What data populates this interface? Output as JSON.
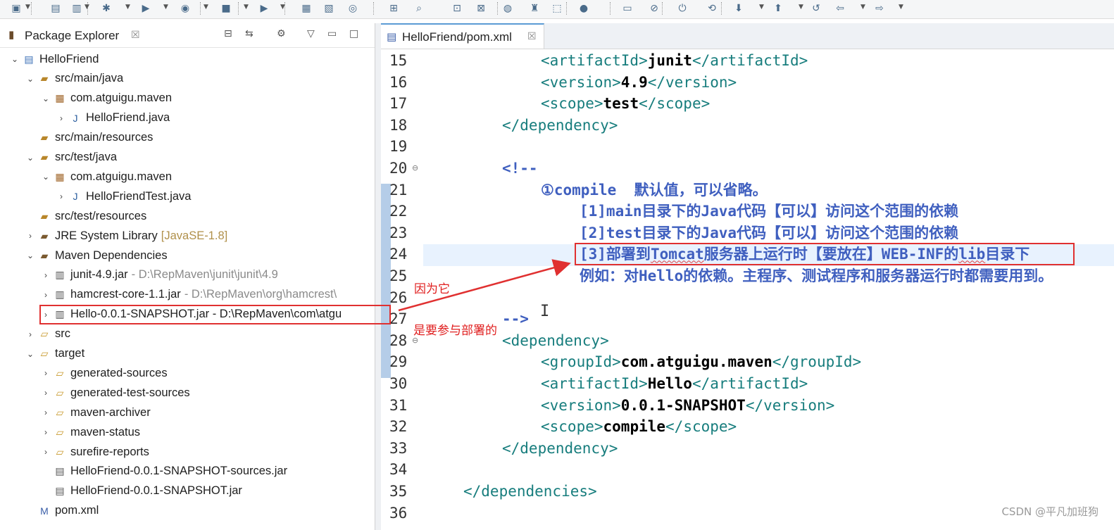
{
  "toolbar": {
    "buttons": [
      "new-icon",
      "save-icon",
      "save-all-icon",
      "debug-icon",
      "run-icon",
      "coverage-icon",
      "stop-icon",
      "external-tools-icon",
      "new-java-project-icon",
      "new-package-icon",
      "new-class-icon",
      "open-type-icon",
      "search-icon",
      "open-task-icon",
      "open-resource-icon",
      "web-browser-icon",
      "ant-icon",
      "remote-icon",
      "user-icon",
      "console-icon",
      "pin-icon",
      "server-start-icon",
      "server-stop-icon",
      "next-annotation-icon",
      "prev-annotation-icon",
      "last-edit-icon",
      "back-icon",
      "forward-icon"
    ]
  },
  "explorer": {
    "title": "Package Explorer",
    "close_glyph": "☒",
    "tree": [
      {
        "label": "HelloFriend",
        "extra": "",
        "level": 0,
        "expand": "open",
        "icon": "project-icon"
      },
      {
        "label": "src/main/java",
        "extra": "",
        "level": 1,
        "expand": "open",
        "icon": "source-folder-icon"
      },
      {
        "label": "com.atguigu.maven",
        "extra": "",
        "level": 2,
        "expand": "open",
        "icon": "package-icon"
      },
      {
        "label": "HelloFriend.java",
        "extra": "",
        "level": 3,
        "expand": "closed",
        "icon": "java-file-icon"
      },
      {
        "label": "src/main/resources",
        "extra": "",
        "level": 1,
        "expand": "none",
        "icon": "source-folder-icon"
      },
      {
        "label": "src/test/java",
        "extra": "",
        "level": 1,
        "expand": "open",
        "icon": "source-folder-icon"
      },
      {
        "label": "com.atguigu.maven",
        "extra": "",
        "level": 2,
        "expand": "open",
        "icon": "package-icon"
      },
      {
        "label": "HelloFriendTest.java",
        "extra": "",
        "level": 3,
        "expand": "closed",
        "icon": "java-file-icon"
      },
      {
        "label": "src/test/resources",
        "extra": "",
        "level": 1,
        "expand": "none",
        "icon": "source-folder-icon"
      },
      {
        "label": "JRE System Library",
        "extra": "[JavaSE-1.8]",
        "level": 1,
        "expand": "closed",
        "icon": "library-icon"
      },
      {
        "label": "Maven Dependencies",
        "extra": "",
        "level": 1,
        "expand": "open",
        "icon": "library-icon"
      },
      {
        "label": "junit-4.9.jar",
        "extra": "- D:\\RepMaven\\junit\\junit\\4.9",
        "level": 2,
        "expand": "closed",
        "icon": "jar-icon"
      },
      {
        "label": "hamcrest-core-1.1.jar",
        "extra": "- D:\\RepMaven\\org\\hamcrest\\",
        "level": 2,
        "expand": "closed",
        "icon": "jar-icon"
      },
      {
        "label": "Hello-0.0.1-SNAPSHOT.jar - D:\\RepMaven\\com\\atgu",
        "extra": "",
        "level": 2,
        "expand": "closed",
        "icon": "jar-icon"
      },
      {
        "label": "src",
        "extra": "",
        "level": 1,
        "expand": "closed",
        "icon": "folder-icon"
      },
      {
        "label": "target",
        "extra": "",
        "level": 1,
        "expand": "open",
        "icon": "folder-icon"
      },
      {
        "label": "generated-sources",
        "extra": "",
        "level": 2,
        "expand": "closed",
        "icon": "folder-icon"
      },
      {
        "label": "generated-test-sources",
        "extra": "",
        "level": 2,
        "expand": "closed",
        "icon": "folder-icon"
      },
      {
        "label": "maven-archiver",
        "extra": "",
        "level": 2,
        "expand": "closed",
        "icon": "folder-icon"
      },
      {
        "label": "maven-status",
        "extra": "",
        "level": 2,
        "expand": "closed",
        "icon": "folder-icon"
      },
      {
        "label": "surefire-reports",
        "extra": "",
        "level": 2,
        "expand": "closed",
        "icon": "folder-icon"
      },
      {
        "label": "HelloFriend-0.0.1-SNAPSHOT-sources.jar",
        "extra": "",
        "level": 2,
        "expand": "none",
        "icon": "archive-icon"
      },
      {
        "label": "HelloFriend-0.0.1-SNAPSHOT.jar",
        "extra": "",
        "level": 2,
        "expand": "none",
        "icon": "archive-icon"
      },
      {
        "label": "pom.xml",
        "extra": "",
        "level": 1,
        "expand": "none",
        "icon": "xml-file-icon"
      }
    ]
  },
  "editor": {
    "tab_title": "HelloFriend/pom.xml",
    "close_glyph": "☒",
    "line_numbers": [
      "15",
      "16",
      "17",
      "18",
      "19",
      "20",
      "21",
      "22",
      "23",
      "24",
      "25",
      "26",
      "27",
      "28",
      "29",
      "30",
      "31",
      "32",
      "33",
      "34",
      "35",
      "36"
    ],
    "lines": [
      [
        {
          "c": "tag",
          "t": "<artifactId>"
        },
        {
          "c": "txt",
          "t": "junit"
        },
        {
          "c": "tag",
          "t": "</artifactId>"
        }
      ],
      [
        {
          "c": "tag",
          "t": "<version>"
        },
        {
          "c": "txt",
          "t": "4.9"
        },
        {
          "c": "tag",
          "t": "</version>"
        }
      ],
      [
        {
          "c": "tag",
          "t": "<scope>"
        },
        {
          "c": "txt",
          "t": "test"
        },
        {
          "c": "tag",
          "t": "</scope>"
        }
      ],
      [
        {
          "c": "tag",
          "t": "</dependency>"
        }
      ],
      [],
      [
        {
          "c": "cmt",
          "t": "<!--"
        }
      ],
      [
        {
          "c": "cmt",
          "t": "①compile  默认值，可以省略。"
        }
      ],
      [
        {
          "c": "cmt",
          "t": "[1]main目录下的Java代码【可以】访问这个范围的依赖"
        }
      ],
      [
        {
          "c": "cmt",
          "t": "[2]test目录下的Java代码【可以】访问这个范围的依赖"
        }
      ],
      [
        {
          "c": "cmt",
          "t": "[3]部署到"
        },
        {
          "c": "cmt u",
          "t": "Tomcat"
        },
        {
          "c": "cmt",
          "t": "服务器上运行时【要放在】WEB-INF的"
        },
        {
          "c": "cmt u",
          "t": "lib"
        },
        {
          "c": "cmt",
          "t": "目录下"
        }
      ],
      [
        {
          "c": "cmt",
          "t": "例如：对Hello的依赖。主程序、测试程序和服务器运行时都需要用到。"
        }
      ],
      [],
      [
        {
          "c": "cmt",
          "t": "-->"
        }
      ],
      [
        {
          "c": "tag",
          "t": "<dependency>"
        }
      ],
      [
        {
          "c": "tag",
          "t": "<groupId>"
        },
        {
          "c": "txt",
          "t": "com.atguigu.maven"
        },
        {
          "c": "tag",
          "t": "</groupId>"
        }
      ],
      [
        {
          "c": "tag",
          "t": "<artifactId>"
        },
        {
          "c": "txt",
          "t": "Hello"
        },
        {
          "c": "tag",
          "t": "</artifactId>"
        }
      ],
      [
        {
          "c": "tag",
          "t": "<version>"
        },
        {
          "c": "txt",
          "t": "0.0.1-SNAPSHOT"
        },
        {
          "c": "tag",
          "t": "</version>"
        }
      ],
      [
        {
          "c": "tag",
          "t": "<scope>"
        },
        {
          "c": "txt",
          "t": "compile"
        },
        {
          "c": "tag",
          "t": "</scope>"
        }
      ],
      [
        {
          "c": "tag",
          "t": "</dependency>"
        }
      ],
      [],
      [
        {
          "c": "tag",
          "t": "</dependencies>"
        }
      ],
      []
    ]
  },
  "annotations": {
    "note_1": "因为它",
    "note_2": "是要参与部署的",
    "color": "#e03030"
  },
  "watermark": "CSDN @平凡加班狗"
}
